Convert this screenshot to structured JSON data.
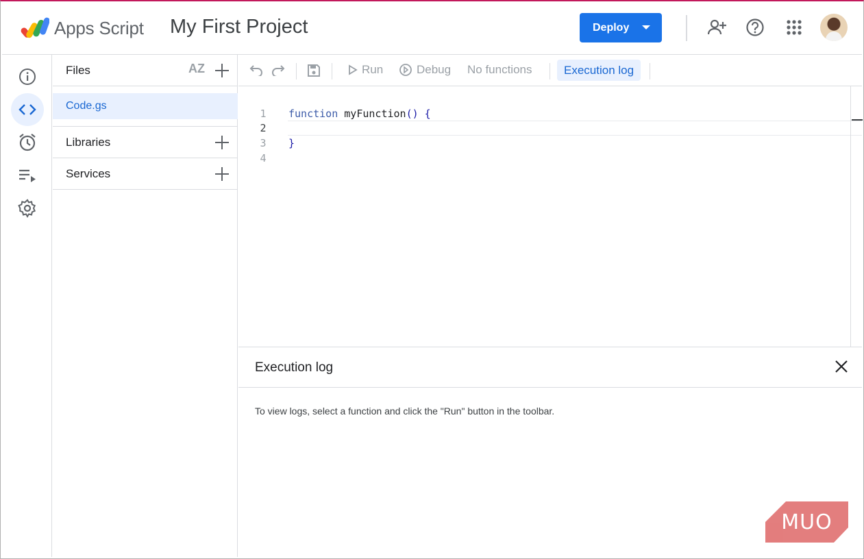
{
  "header": {
    "app_name": "Apps Script",
    "project_title": "My First Project",
    "deploy_label": "Deploy"
  },
  "files_panel": {
    "files_label": "Files",
    "sort_label": "AZ",
    "file_name": "Code.gs",
    "libraries_label": "Libraries",
    "services_label": "Services"
  },
  "toolbar": {
    "run_label": "Run",
    "debug_label": "Debug",
    "function_select": "No functions",
    "execution_log_label": "Execution log"
  },
  "editor": {
    "line_numbers": [
      "1",
      "2",
      "3",
      "4"
    ],
    "line1_keyword": "function",
    "line1_name": "myFunction",
    "line1_rest": "() {",
    "line3": "}"
  },
  "execution_log": {
    "title": "Execution log",
    "message": "To view logs, select a function and click the \"Run\" button in the toolbar."
  },
  "watermark": {
    "text": "MUO"
  },
  "colors": {
    "accent": "#1a73e8",
    "active_bg": "#e8f0fe",
    "active_text": "#1967d2"
  }
}
